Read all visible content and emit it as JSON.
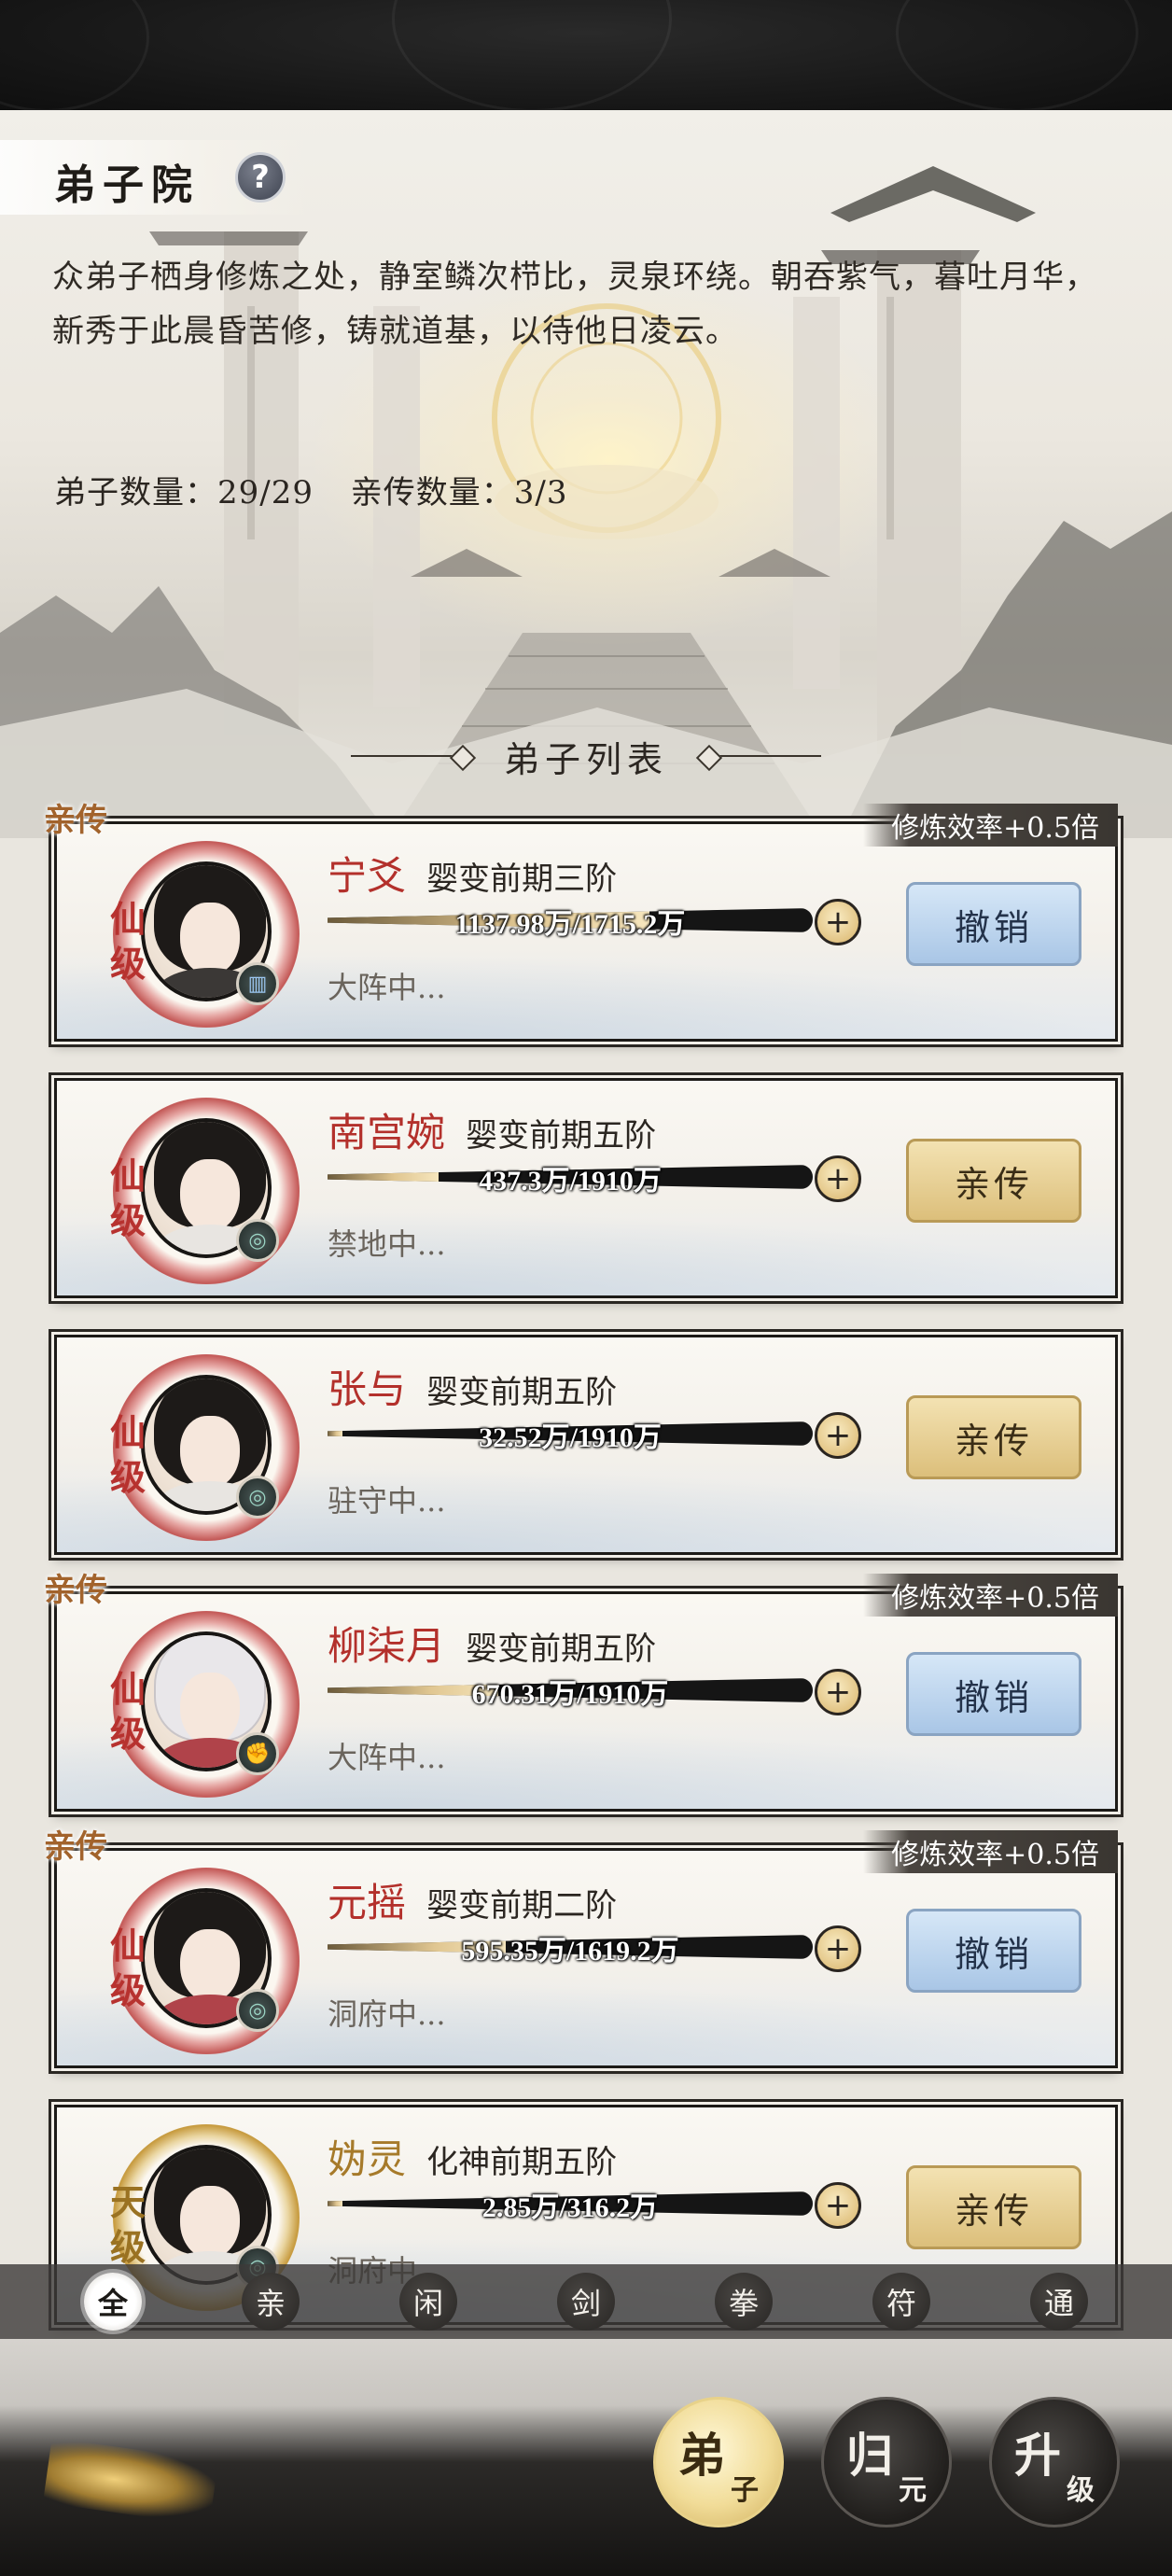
{
  "header": {
    "title": "弟子院",
    "help_label": "?",
    "intro": "众弟子栖身修炼之处，静室鳞次栉比，灵泉环绕。朝吞紫气，暮吐月华，新秀于此晨昏苦修，铸就道基，以待他日凌云。",
    "disciple_count": "弟子数量：29/29",
    "direct_count": "亲传数量：3/3",
    "list_title": "弟子列表"
  },
  "disciples": [
    {
      "name": "宁爻",
      "realm": "婴变前期三阶",
      "progress": "1137.98万/1715.2万",
      "progress_fraction": 0.663,
      "status": "大阵中...",
      "grade": "仙级",
      "is_direct": true,
      "direct_label": "亲传",
      "bonus": "修炼效率+0.5倍",
      "action": "撤销",
      "element_icon": "formation-icon"
    },
    {
      "name": "南宫婉",
      "realm": "婴变前期五阶",
      "progress": "437.3万/1910万",
      "progress_fraction": 0.229,
      "status": "禁地中...",
      "grade": "仙级",
      "is_direct": false,
      "action": "亲传",
      "element_icon": "swirl-icon"
    },
    {
      "name": "张与",
      "realm": "婴变前期五阶",
      "progress": "32.52万/1910万",
      "progress_fraction": 0.017,
      "status": "驻守中...",
      "grade": "仙级",
      "is_direct": false,
      "action": "亲传",
      "element_icon": "swirl-icon"
    },
    {
      "name": "柳柒月",
      "realm": "婴变前期五阶",
      "progress": "670.31万/1910万",
      "progress_fraction": 0.351,
      "status": "大阵中...",
      "grade": "仙级",
      "is_direct": true,
      "direct_label": "亲传",
      "bonus": "修炼效率+0.5倍",
      "action": "撤销",
      "element_icon": "fist-icon"
    },
    {
      "name": "元摇",
      "realm": "婴变前期二阶",
      "progress": "595.35万/1619.2万",
      "progress_fraction": 0.368,
      "status": "洞府中...",
      "grade": "仙级",
      "is_direct": true,
      "direct_label": "亲传",
      "bonus": "修炼效率+0.5倍",
      "action": "撤销",
      "element_icon": "swirl-icon"
    },
    {
      "name": "妫灵",
      "realm": "化神前期五阶",
      "progress": "2.85万/316.2万",
      "progress_fraction": 0.009,
      "status": "洞府中...",
      "grade": "天级",
      "is_direct": false,
      "action": "亲传",
      "element_icon": "swirl-icon"
    }
  ],
  "filters": [
    "全",
    "亲",
    "闲",
    "剑",
    "拳",
    "符",
    "通"
  ],
  "active_filter": "全",
  "bottom_nav": [
    {
      "big": "弟",
      "small": "子",
      "active": true
    },
    {
      "big": "归",
      "small": "元",
      "active": false
    },
    {
      "big": "升",
      "small": "级",
      "active": false
    }
  ]
}
